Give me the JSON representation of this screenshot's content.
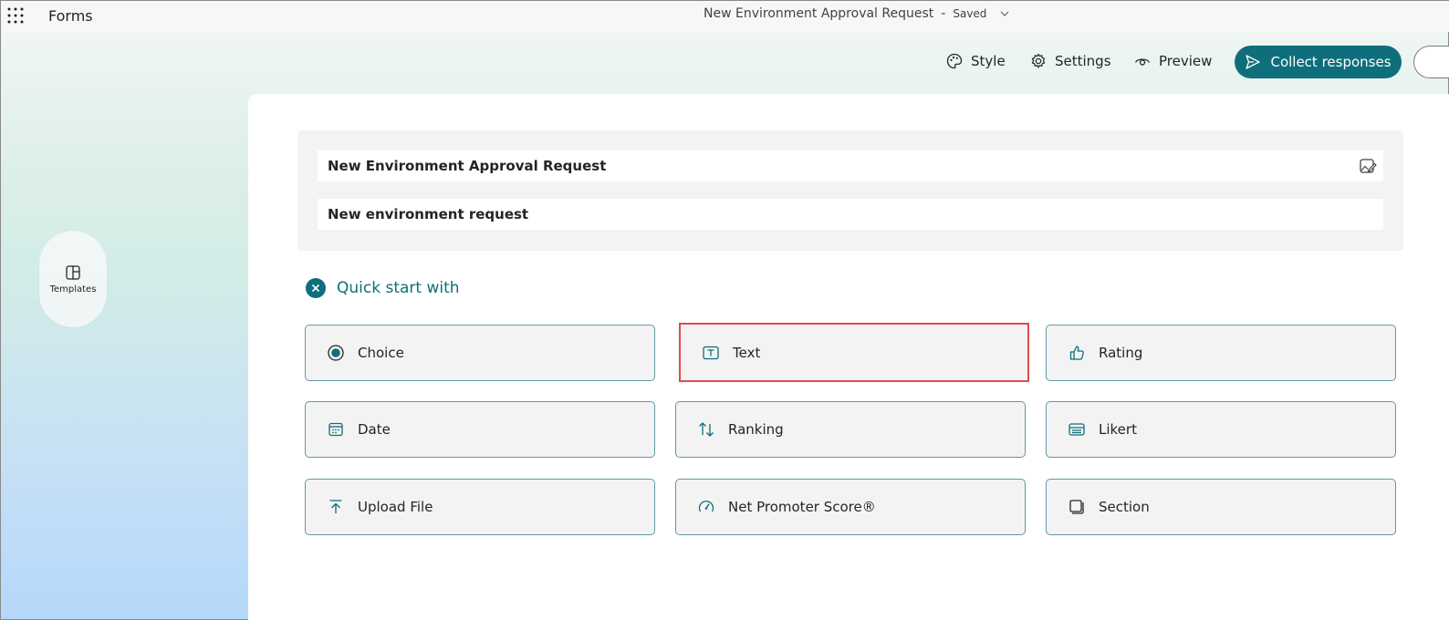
{
  "app": {
    "name": "Forms"
  },
  "document": {
    "title": "New Environment Approval Request",
    "separator": "-",
    "status": "Saved"
  },
  "commands": {
    "style": "Style",
    "settings": "Settings",
    "preview": "Preview",
    "collect": "Collect responses"
  },
  "sidebar": {
    "templates_label": "Templates"
  },
  "form": {
    "title": "New Environment Approval Request",
    "description": "New environment request"
  },
  "quick_start": {
    "label": "Quick start with",
    "items": [
      {
        "label": "Choice",
        "icon": "radio-icon"
      },
      {
        "label": "Text",
        "icon": "text-box-icon",
        "highlighted": true
      },
      {
        "label": "Rating",
        "icon": "thumb-up-icon"
      },
      {
        "label": "Date",
        "icon": "calendar-icon"
      },
      {
        "label": "Ranking",
        "icon": "arrows-up-down-icon"
      },
      {
        "label": "Likert",
        "icon": "likert-grid-icon"
      },
      {
        "label": "Upload File",
        "icon": "upload-icon"
      },
      {
        "label": "Net Promoter Score®",
        "icon": "gauge-icon"
      },
      {
        "label": "Section",
        "icon": "section-icon"
      }
    ]
  },
  "colors": {
    "accent": "#0f6e7b",
    "highlight": "#e14b4b",
    "tile_border": "#5f9aa3"
  }
}
